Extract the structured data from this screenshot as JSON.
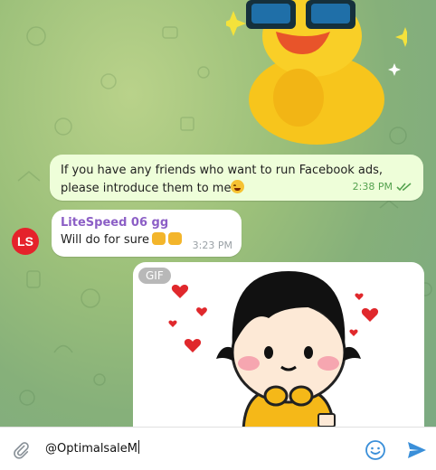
{
  "messages": {
    "outgoing": {
      "text": "If you have any friends who want to run Facebook ads, please introduce them to me",
      "time": "2:38 PM",
      "status_icon": "double-check-icon"
    },
    "incoming": {
      "sender": "LiteSpeed 06 gg",
      "text": "Will do for sure",
      "time": "3:23 PM",
      "avatar_label": "LS"
    },
    "gif": {
      "badge": "GIF"
    }
  },
  "composer": {
    "input_value": "@OptimalsaleM",
    "attach_icon": "paperclip-icon",
    "emoji_icon": "smiley-icon",
    "send_icon": "send-icon"
  },
  "colors": {
    "outgoing_bubble": "#eefed9",
    "sender_name": "#8c5fc6",
    "time_outgoing": "#55a24f",
    "send_accent": "#3a8fd9",
    "avatar_bg": "#e5222b"
  }
}
